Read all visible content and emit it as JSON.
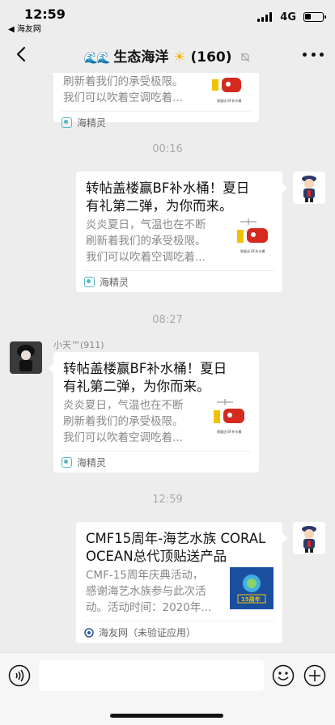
{
  "status_bar": {
    "time": "12:59",
    "back_app": "◀ 海友网",
    "network": "4G"
  },
  "nav": {
    "waves": "🌊🌊",
    "title": "生态海洋",
    "sun": "☀",
    "count": "(160)"
  },
  "messages": [
    {
      "card_title": "",
      "desc_lines": [
        "刷新着我们的承受极限。",
        "我们可以吹着空调吃着..."
      ],
      "source": "海精灵"
    },
    {
      "time": "00:16",
      "card_title_1": "转帖盖楼赢BF补水桶！夏日",
      "card_title_2": "有礼第二弹，为你而来。",
      "desc_lines": [
        "炎炎夏日，气温也在不断",
        "刷新着我们的承受极限。",
        "我们可以吹着空调吃着..."
      ],
      "source": "海精灵"
    },
    {
      "time": "08:27",
      "sender": "小天™(911)",
      "card_title_1": "转帖盖楼赢BF补水桶！夏日",
      "card_title_2": "有礼第二弹，为你而来。",
      "desc_lines": [
        "炎炎夏日，气温也在不断",
        "刷新着我们的承受极限。",
        "我们可以吹着空调吃着..."
      ],
      "source": "海精灵"
    },
    {
      "time": "12:59",
      "card_title_1": "CMF15周年-海艺水族 CORAL",
      "card_title_2": "OCEAN总代顶贴送产品",
      "desc_lines": [
        "CMF-15周年庆典活动，",
        "感谢海艺水族参与此次活",
        "动。活动时间：2020年..."
      ],
      "source": "海友网（未验证应用）"
    }
  ],
  "colors": {
    "background": "#ededed",
    "card": "#ffffff",
    "muted_text": "#888888",
    "timestamp": "#aaaaaa",
    "app_icon": "#55b8c2"
  }
}
